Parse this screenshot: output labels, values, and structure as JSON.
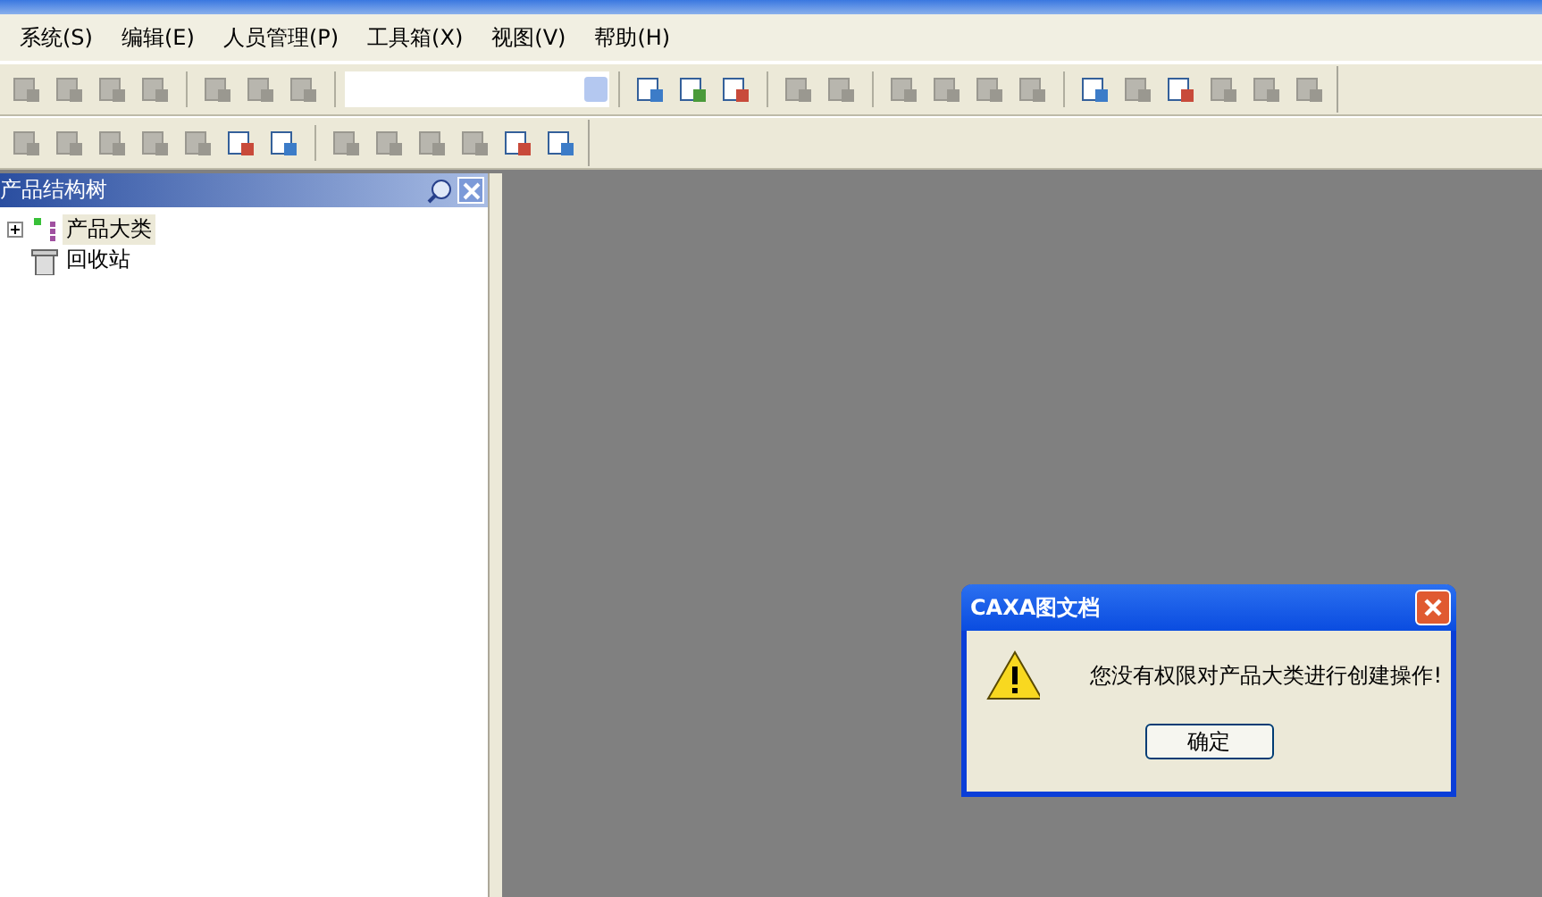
{
  "menu": [
    {
      "label": "系统(S)"
    },
    {
      "label": "编辑(E)"
    },
    {
      "label": "人员管理(P)"
    },
    {
      "label": "工具箱(X)"
    },
    {
      "label": "视图(V)"
    },
    {
      "label": "帮助(H)"
    }
  ],
  "toolbar_rows": [
    [
      {
        "kind": "group",
        "buttons": [
          {
            "disabled": true
          },
          {
            "disabled": true
          },
          {
            "disabled": true
          },
          {
            "disabled": true
          }
        ]
      },
      {
        "kind": "group",
        "buttons": [
          {
            "disabled": true
          },
          {
            "disabled": true
          },
          {
            "disabled": true
          }
        ]
      },
      {
        "kind": "combo"
      },
      {
        "kind": "group",
        "buttons": [
          {
            "disabled": false
          },
          {
            "disabled": false
          },
          {
            "disabled": false
          }
        ]
      },
      {
        "kind": "group",
        "buttons": [
          {
            "disabled": true
          },
          {
            "disabled": true
          }
        ]
      },
      {
        "kind": "group",
        "buttons": [
          {
            "disabled": true
          },
          {
            "disabled": true
          },
          {
            "disabled": true
          },
          {
            "disabled": true
          }
        ]
      },
      {
        "kind": "group",
        "buttons": [
          {
            "disabled": false
          },
          {
            "disabled": true
          },
          {
            "disabled": false
          },
          {
            "disabled": true
          },
          {
            "disabled": true
          },
          {
            "disabled": true
          }
        ]
      }
    ],
    [
      {
        "kind": "group",
        "buttons": [
          {
            "disabled": true
          },
          {
            "disabled": true
          },
          {
            "disabled": true
          },
          {
            "disabled": true
          },
          {
            "disabled": true
          },
          {
            "disabled": false
          },
          {
            "disabled": false
          }
        ]
      },
      {
        "kind": "group",
        "buttons": [
          {
            "disabled": true
          },
          {
            "disabled": true
          },
          {
            "disabled": true
          },
          {
            "disabled": true
          },
          {
            "disabled": false
          },
          {
            "disabled": false
          }
        ]
      }
    ]
  ],
  "panel": {
    "title": "产品结构树",
    "tree": [
      {
        "label": "产品大类",
        "kind": "category",
        "expanded": false,
        "selected": true
      },
      {
        "label": "回收站",
        "kind": "trash",
        "selected": false
      }
    ]
  },
  "dialog": {
    "title": "CAXA图文档",
    "message": "您没有权限对产品大类进行创建操作!",
    "button": "确定"
  }
}
